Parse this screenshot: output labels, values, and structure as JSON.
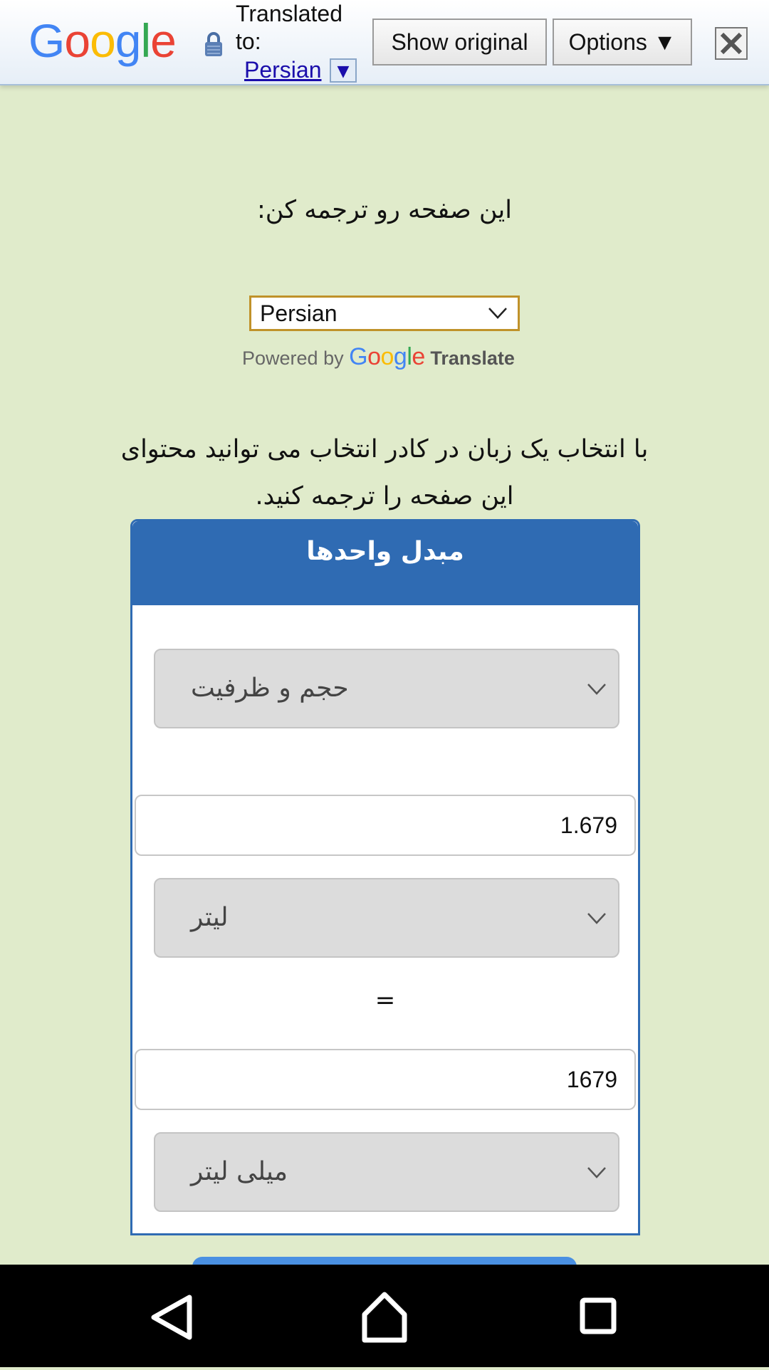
{
  "translate_bar": {
    "logo_text": "Google",
    "translated_label": "Translated to:",
    "language_link": "Persian",
    "dropdown_glyph": "▼",
    "show_original_label": "Show original",
    "options_label": "Options ▼",
    "icons": [
      "google-logo",
      "lock-icon",
      "close-icon"
    ]
  },
  "page": {
    "translate_prompt": "این صفحه رو ترجمه کن:",
    "language_select": {
      "selected": "Persian"
    },
    "powered_by": "Powered by",
    "powered_google": "Google",
    "powered_translate": "Translate",
    "description": "با انتخاب یک زبان در کادر انتخاب می توانید محتوای این صفحه را ترجمه کنید."
  },
  "converter": {
    "title": "مبدل واحدها",
    "category_select": "حجم و ظرفیت",
    "input_value": "1.679",
    "from_unit": "لیتر",
    "equals": "=",
    "output_value": "1679",
    "to_unit": "میلی لیتر"
  },
  "nav": {
    "icons": [
      "back-icon",
      "home-icon",
      "recents-icon"
    ]
  },
  "colors": {
    "page_bg": "#e0ebcb",
    "card_accent": "#2f6bb3",
    "select_bg": "#dcdcdc"
  }
}
